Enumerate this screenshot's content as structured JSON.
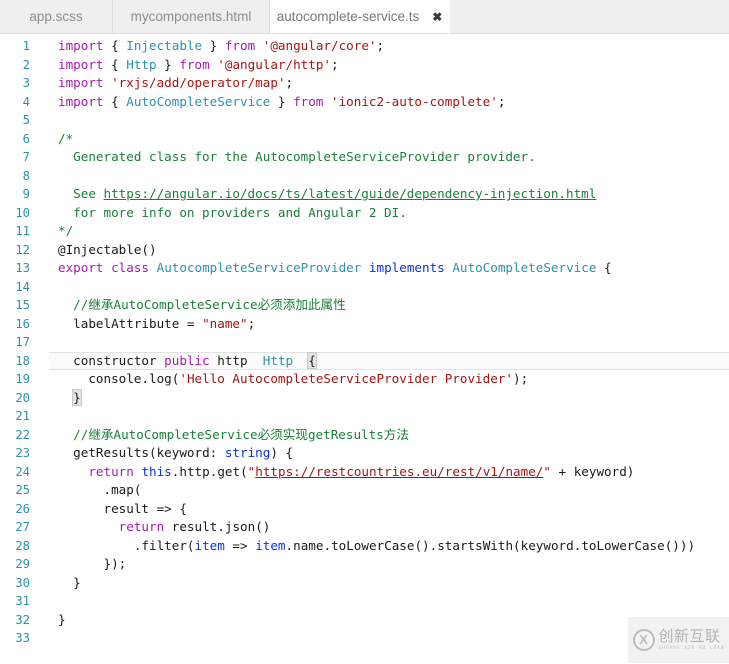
{
  "tabs": [
    {
      "label": "app.scss",
      "active": false,
      "closable": false
    },
    {
      "label": "mycomponents.html",
      "active": false,
      "closable": false
    },
    {
      "label": "autocomplete-service.ts",
      "active": true,
      "closable": true,
      "close_glyph": "✖"
    }
  ],
  "editor": {
    "language": "typescript",
    "current_line": 18,
    "first_line": 1,
    "last_line": 33,
    "lines": [
      {
        "n": 1,
        "text": "import { Injectable } from '@angular/core';"
      },
      {
        "n": 2,
        "text": "import { Http } from '@angular/http';"
      },
      {
        "n": 3,
        "text": "import 'rxjs/add/operator/map';"
      },
      {
        "n": 4,
        "text": "import { AutoCompleteService } from 'ionic2-auto-complete';"
      },
      {
        "n": 5,
        "text": ""
      },
      {
        "n": 6,
        "text": "/*"
      },
      {
        "n": 7,
        "text": "  Generated class for the AutocompleteServiceProvider provider."
      },
      {
        "n": 8,
        "text": ""
      },
      {
        "n": 9,
        "text": "  See https://angular.io/docs/ts/latest/guide/dependency-injection.html"
      },
      {
        "n": 10,
        "text": "  for more info on providers and Angular 2 DI."
      },
      {
        "n": 11,
        "text": "*/"
      },
      {
        "n": 12,
        "text": "@Injectable()"
      },
      {
        "n": 13,
        "text": "export class AutocompleteServiceProvider implements AutoCompleteService {"
      },
      {
        "n": 14,
        "text": ""
      },
      {
        "n": 15,
        "text": "  //继承AutoCompleteService必须添加此属性"
      },
      {
        "n": 16,
        "text": "  labelAttribute = \"name\";"
      },
      {
        "n": 17,
        "text": ""
      },
      {
        "n": 18,
        "text": "  constructor(public http: Http) {"
      },
      {
        "n": 19,
        "text": "    console.log('Hello AutocompleteServiceProvider Provider');"
      },
      {
        "n": 20,
        "text": "  }"
      },
      {
        "n": 21,
        "text": ""
      },
      {
        "n": 22,
        "text": "  //继承AutoCompleteService必须实现getResults方法"
      },
      {
        "n": 23,
        "text": "  getResults(keyword: string) {"
      },
      {
        "n": 24,
        "text": "    return this.http.get(\"https://restcountries.eu/rest/v1/name/\" + keyword)"
      },
      {
        "n": 25,
        "text": "      .map("
      },
      {
        "n": 26,
        "text": "      result => {"
      },
      {
        "n": 27,
        "text": "        return result.json()"
      },
      {
        "n": 28,
        "text": "          .filter(item => item.name.toLowerCase().startsWith(keyword.toLowerCase()))"
      },
      {
        "n": 29,
        "text": "      });"
      },
      {
        "n": 30,
        "text": "  }"
      },
      {
        "n": 31,
        "text": ""
      },
      {
        "n": 32,
        "text": "}"
      },
      {
        "n": 33,
        "text": ""
      }
    ],
    "links": [
      "https://angular.io/docs/ts/latest/guide/dependency-injection.html",
      "https://restcountries.eu/rest/v1/name/"
    ]
  },
  "watermark": {
    "logo_glyph": "X",
    "chinese": "创新互联",
    "pinyin": "CHUANG XIN HU LIAN"
  },
  "colors": {
    "keyword": "#a31bb5",
    "keyword_alt": "#0a35d6",
    "type": "#2b91af",
    "string": "#a31515",
    "comment": "#1a7f37",
    "plain": "#1a1a1a",
    "line_number": "#2b91af",
    "tab_bar_bg": "#efefef",
    "active_tab_bg": "#ffffff",
    "editor_bg": "#ffffff"
  }
}
